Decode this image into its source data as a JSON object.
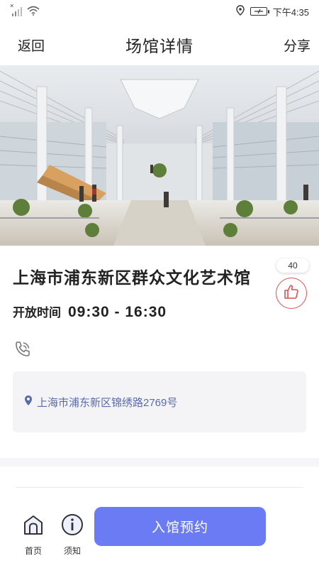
{
  "status_bar": {
    "time": "下午4:35",
    "signal_mark": "×"
  },
  "nav": {
    "back_label": "返回",
    "title": "场馆详情",
    "share_label": "分享"
  },
  "hero": {
    "description_icon": "venue-hall-photo"
  },
  "venue": {
    "name": "上海市浦东新区群众文化艺术馆",
    "hours_label": "开放时间",
    "hours_value": "09:30 - 16:30",
    "like_count": "40",
    "address": "上海市浦东新区锦绣路2769号"
  },
  "tabbar": {
    "home_label": "首页",
    "notice_label": "须知",
    "reserve_label": "入馆预约"
  },
  "colors": {
    "accent": "#6b7bf3",
    "like": "#d9534f",
    "address_text": "#5a6ba8"
  }
}
